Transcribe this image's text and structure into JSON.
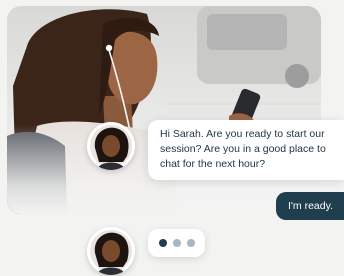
{
  "chat": {
    "agent_message": "Hi Sarah. Are you ready to start our session? Are you in a good place to chat for the next hour?",
    "user_message": "I'm ready.",
    "typing_state": "typing"
  },
  "colors": {
    "user_bubble": "#1f3f4f",
    "agent_text": "#1c3443",
    "typing_dot_active": "#1f3f4f",
    "typing_dot_inactive": "#a7b6bf",
    "page_background": "#f3f3f2"
  }
}
